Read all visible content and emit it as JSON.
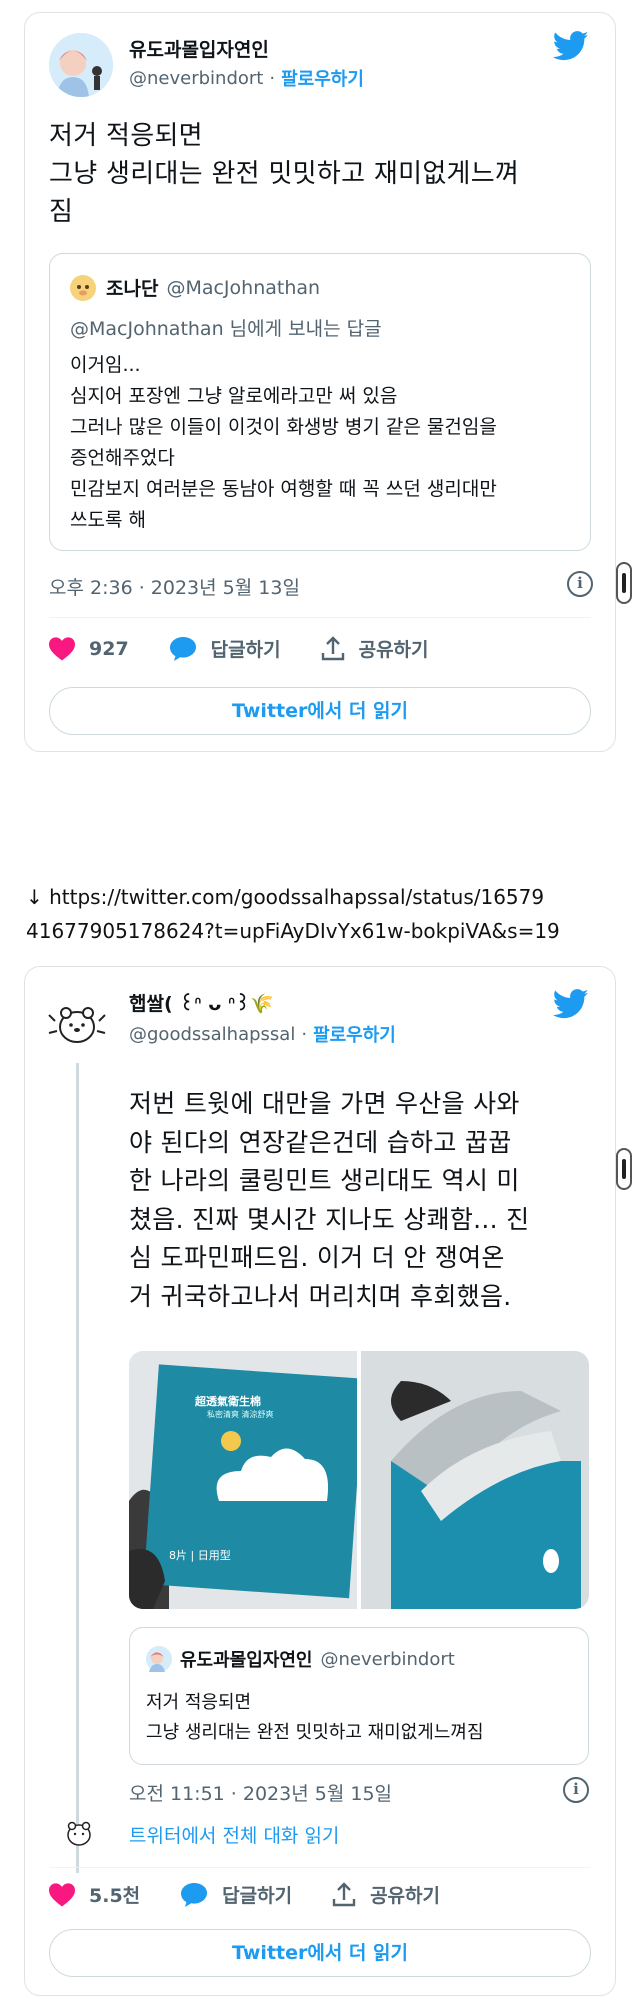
{
  "tweet1": {
    "author_name": "유도과몰입자연인",
    "author_handle": "@neverbindort",
    "separator": "·",
    "follow_label": "팔로우하기",
    "text": "저거 적응되면\n그냥 생리대는 완전 밋밋하고 재미없게느껴\n짐",
    "quote": {
      "name": "조나단",
      "handle": "@MacJohnathan",
      "reply_to": "@MacJohnathan 님에게 보내는 답글",
      "text": "이거임...\n심지어 포장엔 그냥 알로에라고만 써 있음\n그러나 많은 이들이 이것이 화생방 병기 같은 물건임을\n증언해주었다\n민감보지 여러분은 동남아 여행할 때 꼭 쓰던 생리대만\n쓰도록 해"
    },
    "timestamp": "오후 2:36 · 2023년 5월 13일",
    "like_count": "927",
    "reply_label": "답글하기",
    "share_label": "공유하기",
    "read_more_label": "Twitter에서 더 읽기"
  },
  "url_line": "↓ https://twitter.com/goodssalhapssal/status/16579\n41677905178624?t=upFiAyDIvYx61w-bokpiVA&s=19",
  "tweet2": {
    "author_name": "햅쌀( ꒰ᐢ ᴗ ᐢ꒱🌾",
    "author_handle": "@goodssalhapssal",
    "separator": "·",
    "follow_label": "팔로우하기",
    "text": "저번 트윗에 대만을 가면 우산을 사와\n야 된다의 연장같은건데 습하고 꿉꿉\n한 나라의 쿨링민트 생리대도 역시 미\n쳤음. 진짜 몇시간 지나도 상쾌함... 진\n심 도파민패드임. 이거 더 안 쟁여온\n거 귀국하고나서 머리치며 후회했음.",
    "image_left": {
      "brand": "超透氣衛生棉",
      "sub": "私密清爽 清涼舒爽",
      "count": "8片 | 日用型"
    },
    "quote": {
      "name": "유도과몰입자연인",
      "handle": "@neverbindort",
      "text": "저거 적응되면\n그냥 생리대는 완전 밋밋하고 재미없게느껴짐"
    },
    "timestamp": "오전 11:51 · 2023년 5월 15일",
    "thread_label": "트위터에서 전체 대화 읽기",
    "like_count": "5.5천",
    "reply_label": "답글하기",
    "share_label": "공유하기",
    "read_more_label": "Twitter에서 더 읽기"
  },
  "colors": {
    "twitter_blue": "#1d9bf0",
    "heart_pink": "#f91880",
    "gray_text": "#536471",
    "border": "#cfd9de"
  }
}
